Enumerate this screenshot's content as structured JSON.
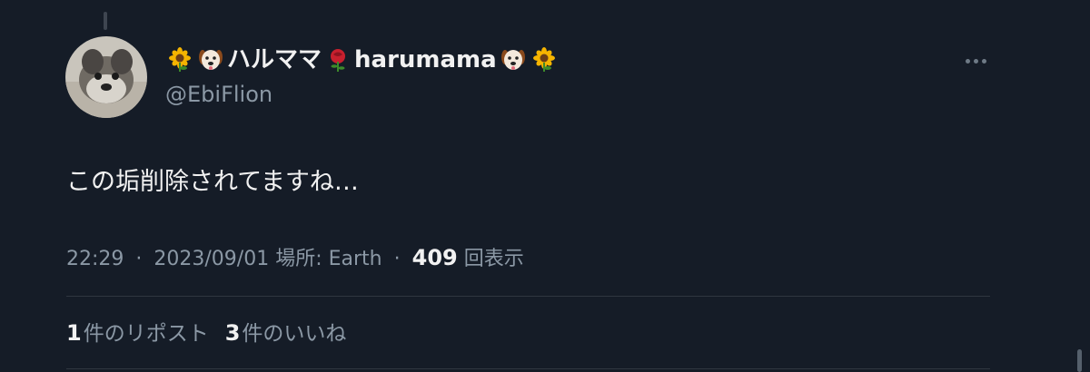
{
  "tweet": {
    "display_name": "ハルママ",
    "display_name_latin": "harumama",
    "name_emojis": [
      "sunflower-emoji",
      "dog-face-emoji",
      "rose-emoji",
      "dog-face-emoji",
      "sunflower-emoji"
    ],
    "handle": "@EbiFlion",
    "text": "この垢削除されてますね…",
    "time": "22:29",
    "date": "2023/09/01",
    "location_label": "場所: Earth",
    "separator": "·",
    "views_count": "409",
    "views_label": "回表示",
    "reposts_count": "1",
    "reposts_label": "件のリポスト",
    "likes_count": "3",
    "likes_label": "件のいいね"
  },
  "icons": {
    "more": "more-horizontal-icon"
  },
  "colors": {
    "background": "#151c27",
    "text_primary": "#e7e9ea",
    "text_secondary": "#8b98a5",
    "divider": "#2f3640"
  }
}
